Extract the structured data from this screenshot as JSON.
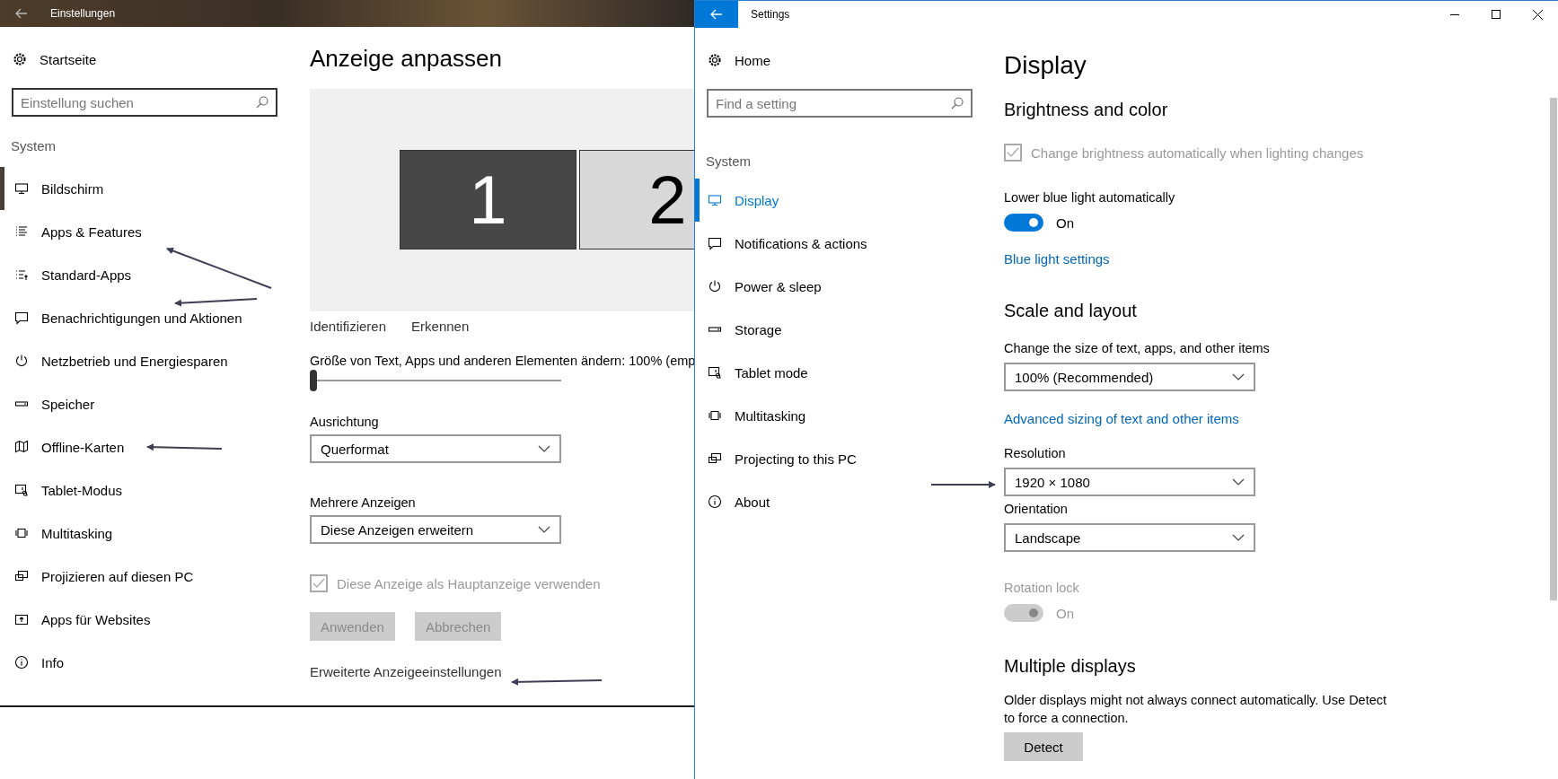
{
  "left_window": {
    "title": "Einstellungen",
    "home": "Startseite",
    "search": {
      "placeholder": "Einstellung suchen"
    },
    "section": "System",
    "nav": [
      {
        "label": "Bildschirm",
        "selected": true
      },
      {
        "label": "Apps & Features",
        "selected": false
      },
      {
        "label": "Standard-Apps",
        "selected": false
      },
      {
        "label": "Benachrichtigungen und Aktionen",
        "selected": false
      },
      {
        "label": "Netzbetrieb und Energiesparen",
        "selected": false
      },
      {
        "label": "Speicher",
        "selected": false
      },
      {
        "label": "Offline-Karten",
        "selected": false
      },
      {
        "label": "Tablet-Modus",
        "selected": false
      },
      {
        "label": "Multitasking",
        "selected": false
      },
      {
        "label": "Projizieren auf diesen PC",
        "selected": false
      },
      {
        "label": "Apps für Websites",
        "selected": false
      },
      {
        "label": "Info",
        "selected": false
      }
    ],
    "page_title": "Anzeige anpassen",
    "items": [
      {
        "kind": "preview",
        "monitors": [
          {
            "label": "1",
            "selected": true
          },
          {
            "label": "2",
            "selected": false
          }
        ]
      },
      {
        "kind": "actions",
        "links": [
          "Identifizieren",
          "Erkennen"
        ]
      },
      {
        "kind": "slider",
        "label": "Größe von Text, Apps und anderen Elementen ändern: 100% (emp",
        "level": 0
      },
      {
        "kind": "dropdown",
        "label": "Ausrichtung",
        "value": "Querformat"
      },
      {
        "kind": "dropdown",
        "label": "Mehrere Anzeigen",
        "value": "Diese Anzeigen erweitern"
      },
      {
        "kind": "checkbox",
        "label": "Diese Anzeige als Hauptanzeige verwenden",
        "checked": true,
        "disabled": true
      },
      {
        "kind": "buttons",
        "buttons": [
          {
            "label": "Anwenden",
            "disabled": true
          },
          {
            "label": "Abbrechen",
            "disabled": true
          }
        ]
      },
      {
        "kind": "plain-link",
        "label": "Erweiterte Anzeigeeinstellungen"
      }
    ]
  },
  "right_window": {
    "title": "Settings",
    "home": "Home",
    "search": {
      "placeholder": "Find a setting"
    },
    "section": "System",
    "nav": [
      {
        "label": "Display",
        "selected": true
      },
      {
        "label": "Notifications & actions",
        "selected": false
      },
      {
        "label": "Power & sleep",
        "selected": false
      },
      {
        "label": "Storage",
        "selected": false
      },
      {
        "label": "Tablet mode",
        "selected": false
      },
      {
        "label": "Multitasking",
        "selected": false
      },
      {
        "label": "Projecting to this PC",
        "selected": false
      },
      {
        "label": "About",
        "selected": false
      }
    ],
    "page_title": "Display",
    "items": [
      {
        "kind": "heading",
        "label": "Brightness and color"
      },
      {
        "kind": "checkbox",
        "label": "Change brightness automatically when lighting changes",
        "checked": true,
        "disabled": true
      },
      {
        "kind": "toggle",
        "label": "Lower blue light automatically",
        "on": true,
        "state_text": "On",
        "disabled": false
      },
      {
        "kind": "link",
        "label": "Blue light settings"
      },
      {
        "kind": "heading",
        "label": "Scale and layout"
      },
      {
        "kind": "dropdown",
        "label": "Change the size of text, apps, and other items",
        "value": "100% (Recommended)"
      },
      {
        "kind": "link",
        "label": "Advanced sizing of text and other items"
      },
      {
        "kind": "dropdown",
        "label": "Resolution",
        "value": "1920 × 1080"
      },
      {
        "kind": "dropdown",
        "label": "Orientation",
        "value": "Landscape"
      },
      {
        "kind": "toggle",
        "label": "Rotation lock",
        "on": true,
        "state_text": "On",
        "disabled": true
      },
      {
        "kind": "heading",
        "label": "Multiple displays"
      },
      {
        "kind": "paragraph",
        "label": "Older displays might not always connect automatically. Use Detect to force a connection."
      },
      {
        "kind": "button",
        "label": "Detect",
        "disabled": false
      }
    ]
  }
}
